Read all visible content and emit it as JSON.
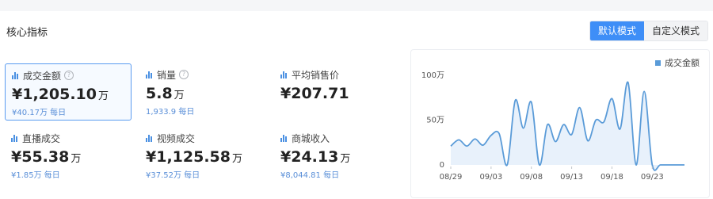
{
  "header": {
    "title": "核心指标",
    "modes": [
      "默认模式",
      "自定义模式"
    ],
    "active_mode": "默认模式"
  },
  "metrics": [
    {
      "label": "成交金额",
      "has_help": true,
      "value": "¥1,205.10",
      "unit": "万",
      "sub": "¥40.17万 每日",
      "selected": true
    },
    {
      "label": "销量",
      "has_help": true,
      "value": "5.8",
      "unit": "万",
      "sub": "1,933.9 每日",
      "selected": false
    },
    {
      "label": "平均销售价",
      "has_help": false,
      "value": "¥207.71",
      "unit": "",
      "sub": "",
      "selected": false
    },
    {
      "label": "直播成交",
      "has_help": false,
      "value": "¥55.38",
      "unit": "万",
      "sub": "¥1.85万 每日",
      "selected": false
    },
    {
      "label": "视频成交",
      "has_help": false,
      "value": "¥1,125.58",
      "unit": "万",
      "sub": "¥37.52万 每日",
      "selected": false
    },
    {
      "label": "商城收入",
      "has_help": false,
      "value": "¥24.13",
      "unit": "万",
      "sub": "¥8,044.81 每日",
      "selected": false
    }
  ],
  "icons": {
    "metric_icon": "bar-chart-icon",
    "help_icon": "question-circle-icon"
  },
  "colors": {
    "accent": "#3e8ef7",
    "line": "#5a9bd8",
    "fill": "#e8f1fb",
    "sub_text": "#5a8fd8"
  },
  "chart_data": {
    "type": "area",
    "legend": [
      "成交金额"
    ],
    "legend_position": "top-right",
    "y_ticks": [
      "0",
      "50万",
      "100万"
    ],
    "ylim": [
      0,
      100
    ],
    "unit": "万",
    "x_ticks": [
      "08/29",
      "09/03",
      "09/08",
      "09/13",
      "09/18",
      "09/23"
    ],
    "x": [
      "08/29",
      "08/30",
      "08/31",
      "09/01",
      "09/02",
      "09/03",
      "09/04",
      "09/05",
      "09/06",
      "09/07",
      "09/08",
      "09/09",
      "09/10",
      "09/11",
      "09/12",
      "09/13",
      "09/14",
      "09/15",
      "09/16",
      "09/17",
      "09/18",
      "09/19",
      "09/20",
      "09/21",
      "09/22",
      "09/23",
      "09/24",
      "09/25",
      "09/26",
      "09/27"
    ],
    "series": [
      {
        "name": "成交金额",
        "values": [
          21,
          28,
          21,
          29,
          22,
          33,
          35,
          0,
          72,
          41,
          70,
          0,
          45,
          26,
          45,
          34,
          64,
          27,
          50,
          48,
          74,
          40,
          92,
          0,
          82,
          0,
          0,
          0,
          0,
          0
        ]
      }
    ],
    "grid": false
  }
}
